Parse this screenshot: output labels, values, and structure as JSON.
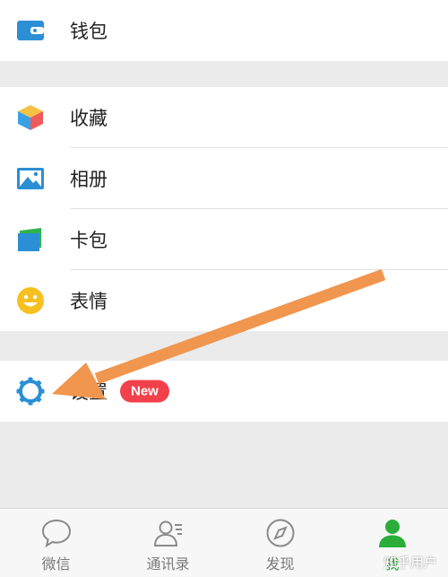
{
  "menu": {
    "wallet": {
      "label": "钱包",
      "icon": "wallet-icon"
    },
    "favorites": {
      "label": "收藏",
      "icon": "cube-icon"
    },
    "album": {
      "label": "相册",
      "icon": "picture-icon"
    },
    "cards": {
      "label": "卡包",
      "icon": "card-icon"
    },
    "stickers": {
      "label": "表情",
      "icon": "smiley-icon"
    },
    "settings": {
      "label": "设置",
      "icon": "gear-icon",
      "badge": "New"
    }
  },
  "tabbar": {
    "tabs": [
      {
        "label": "微信",
        "icon": "chat-bubble-icon"
      },
      {
        "label": "通讯录",
        "icon": "contacts-icon"
      },
      {
        "label": "发现",
        "icon": "compass-icon"
      },
      {
        "label": "我",
        "icon": "person-icon",
        "active": true
      }
    ]
  },
  "watermark": "知乎用户",
  "colors": {
    "accent_green": "#2aae39",
    "badge_red": "#f2414b",
    "icon_blue": "#2b8fd6",
    "arrow_orange": "#f0964f"
  }
}
